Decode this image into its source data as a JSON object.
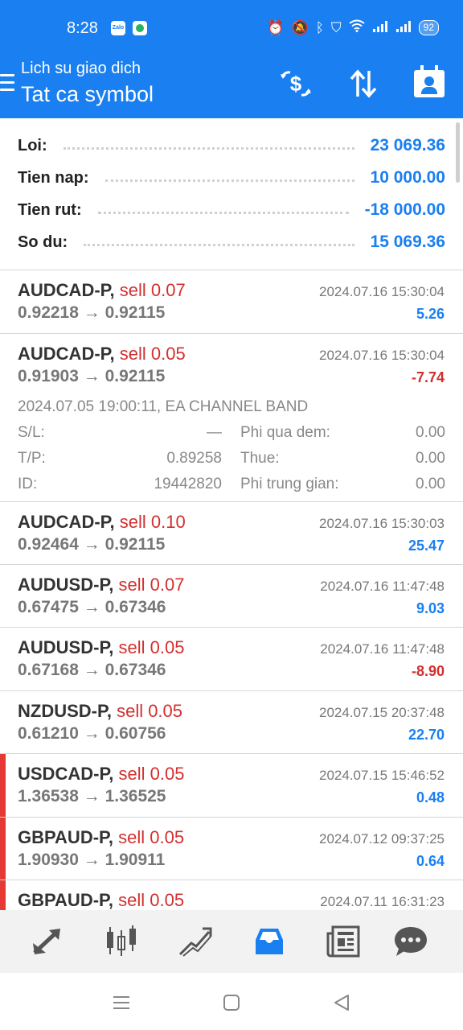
{
  "status_bar": {
    "time": "8:28",
    "zalo_label": "Zalo",
    "battery": "92",
    "icons": [
      "alarm-icon",
      "mute-icon",
      "bluetooth-icon",
      "vpn-shield-icon",
      "wifi-icon",
      "signal-icon",
      "signal-icon",
      "battery-icon"
    ]
  },
  "header": {
    "subtitle": "Lich su giao dich",
    "title": "Tat ca symbol",
    "actions": [
      "dollar-exchange-icon",
      "sort-icon",
      "calendar-icon"
    ],
    "color": "#1a7ff0"
  },
  "summary": {
    "rows": [
      {
        "label": "Loi:",
        "value": "23 069.36"
      },
      {
        "label": "Tien nap:",
        "value": "10 000.00"
      },
      {
        "label": "Tien rut:",
        "value": "-18 000.00"
      },
      {
        "label": "So du:",
        "value": "15 069.36"
      }
    ]
  },
  "trades": [
    {
      "symbol": "AUDCAD-P,",
      "type": "sell 0.07",
      "prices": "0.92218 → 0.92115",
      "datetime": "2024.07.16 15:30:04",
      "pl": "5.26",
      "pl_sign": "pos",
      "marker": false
    },
    {
      "symbol": "AUDCAD-P,",
      "type": "sell 0.05",
      "prices": "0.91903 → 0.92115",
      "datetime": "2024.07.16 15:30:04",
      "pl": "-7.74",
      "pl_sign": "neg",
      "marker": false,
      "expanded": {
        "comment": "2024.07.05 19:00:11, EA CHANNEL BAND",
        "rows": [
          {
            "k1": "S/L:",
            "v1": "—",
            "k2": "Phi qua dem:",
            "v2": "0.00"
          },
          {
            "k1": "T/P:",
            "v1": "0.89258",
            "k2": "Thue:",
            "v2": "0.00"
          },
          {
            "k1": "ID:",
            "v1": "19442820",
            "k2": "Phi trung gian:",
            "v2": "0.00"
          }
        ]
      }
    },
    {
      "symbol": "AUDCAD-P,",
      "type": "sell 0.10",
      "prices": "0.92464 → 0.92115",
      "datetime": "2024.07.16 15:30:03",
      "pl": "25.47",
      "pl_sign": "pos",
      "marker": false
    },
    {
      "symbol": "AUDUSD-P,",
      "type": "sell 0.07",
      "prices": "0.67475 → 0.67346",
      "datetime": "2024.07.16 11:47:48",
      "pl": "9.03",
      "pl_sign": "pos",
      "marker": false
    },
    {
      "symbol": "AUDUSD-P,",
      "type": "sell 0.05",
      "prices": "0.67168 → 0.67346",
      "datetime": "2024.07.16 11:47:48",
      "pl": "-8.90",
      "pl_sign": "neg",
      "marker": false
    },
    {
      "symbol": "NZDUSD-P,",
      "type": "sell 0.05",
      "prices": "0.61210 → 0.60756",
      "datetime": "2024.07.15 20:37:48",
      "pl": "22.70",
      "pl_sign": "pos",
      "marker": false
    },
    {
      "symbol": "USDCAD-P,",
      "type": "sell 0.05",
      "prices": "1.36538 → 1.36525",
      "datetime": "2024.07.15 15:46:52",
      "pl": "0.48",
      "pl_sign": "pos",
      "marker": true
    },
    {
      "symbol": "GBPAUD-P,",
      "type": "sell 0.05",
      "prices": "1.90930 → 1.90911",
      "datetime": "2024.07.12 09:37:25",
      "pl": "0.64",
      "pl_sign": "pos",
      "marker": true
    },
    {
      "symbol": "GBPAUD-P,",
      "type": "sell 0.05",
      "prices": "",
      "datetime": "2024.07.11 16:31:23",
      "pl": "",
      "pl_sign": "pos",
      "marker": true
    }
  ],
  "bottom_nav": {
    "items": [
      "quotes-icon",
      "chart-icon",
      "trade-icon",
      "history-icon",
      "news-icon",
      "chat-icon"
    ],
    "active": "history-icon",
    "active_color": "#1a7ff0"
  },
  "system_nav": [
    "recent-apps-icon",
    "home-icon",
    "back-icon"
  ]
}
